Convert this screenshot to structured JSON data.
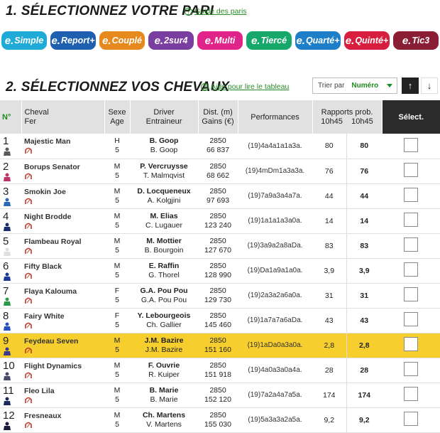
{
  "section1": {
    "title": "1. SÉLECTIONNEZ VOTRE PARI",
    "help": "Guide des paris"
  },
  "bets": [
    {
      "prefix": "e.",
      "label": "Simple",
      "color": "#1faad8"
    },
    {
      "prefix": "e.",
      "label": "Report+",
      "color": "#1e5fb0"
    },
    {
      "prefix": "e.",
      "label": "Couplé",
      "color": "#e68a1e"
    },
    {
      "prefix": "e.",
      "label": "2sur4",
      "color": "#7a3ea0"
    },
    {
      "prefix": "e.",
      "label": "Multi",
      "color": "#e0248a"
    },
    {
      "prefix": "e.",
      "label": "Tiercé",
      "color": "#15a86a"
    },
    {
      "prefix": "e.",
      "label": "Quarté+",
      "color": "#1e7fc8"
    },
    {
      "prefix": "e.",
      "label": "Quinté+",
      "color": "#d81e3e"
    },
    {
      "prefix": "e.",
      "label": "Tic3",
      "color": "#8a1e34"
    }
  ],
  "section2": {
    "title": "2. SÉLECTIONNEZ VOS CHEVAUX",
    "help": "Aide pour lire le tableau"
  },
  "sort": {
    "label": "Trier par",
    "value": "Numéro",
    "up": "↑",
    "down": "↓"
  },
  "columns": {
    "num": "N°",
    "horse": "Cheval",
    "shoe": "Fer",
    "sex": "Sexe",
    "age": "Age",
    "driver": "Driver",
    "trainer": "Entraineur",
    "dist": "Dist. (m)",
    "gains": "Gains (€)",
    "perf": "Performances",
    "odds": "Rapports prob.",
    "odds_t1": "10h45",
    "odds_t2": "10h45",
    "select": "Sélect."
  },
  "rows": [
    {
      "num": "1",
      "name": "Majestic Man",
      "sex": "H",
      "age": "5",
      "driver": "B. Goop",
      "trainer": "B. Goop",
      "dist": "2850",
      "gains": "66 837",
      "perf": "(19)4a4a1a1a3a.",
      "odd1": "80",
      "odd2": "80",
      "jcolor": "#5a5a5a",
      "highlight": false
    },
    {
      "num": "2",
      "name": "Borups Senator",
      "sex": "M",
      "age": "5",
      "driver": "P. Vercruysse",
      "trainer": "T. Malmqvist",
      "dist": "2850",
      "gains": "68 662",
      "perf": "(19)4mDm1a3a3a.",
      "odd1": "76",
      "odd2": "76",
      "jcolor": "#c0306a",
      "highlight": false
    },
    {
      "num": "3",
      "name": "Smokin Joe",
      "sex": "M",
      "age": "5",
      "driver": "D. Locqueneux",
      "trainer": "A. Kolgjini",
      "dist": "2850",
      "gains": "97 693",
      "perf": "(19)7a9a3a4a7a.",
      "odd1": "44",
      "odd2": "44",
      "jcolor": "#2a6ab0",
      "highlight": false
    },
    {
      "num": "4",
      "name": "Night Brodde",
      "sex": "M",
      "age": "5",
      "driver": "M. Elias",
      "trainer": "C. Lugauer",
      "dist": "2850",
      "gains": "123 240",
      "perf": "(19)1a1a1a3a0a.",
      "odd1": "14",
      "odd2": "14",
      "jcolor": "#1a2a6a",
      "highlight": false
    },
    {
      "num": "5",
      "name": "Flambeau Royal",
      "sex": "M",
      "age": "5",
      "driver": "M. Mottier",
      "trainer": "B. Bourgoin",
      "dist": "2850",
      "gains": "127 670",
      "perf": "(19)3a9a2a8aDa.",
      "odd1": "83",
      "odd2": "83",
      "jcolor": "#e0e0e0",
      "highlight": false
    },
    {
      "num": "6",
      "name": "Fifty Black",
      "sex": "M",
      "age": "5",
      "driver": "E. Raffin",
      "trainer": "G. Thorel",
      "dist": "2850",
      "gains": "128 990",
      "perf": "(19)Da1a9a1a0a.",
      "odd1": "3,9",
      "odd2": "3,9",
      "jcolor": "#1a3a9a",
      "highlight": false
    },
    {
      "num": "7",
      "name": "Flaya Kalouma",
      "sex": "F",
      "age": "5",
      "driver": "G.A. Pou Pou",
      "trainer": "G.A. Pou Pou",
      "dist": "2850",
      "gains": "129 730",
      "perf": "(19)2a3a2a6a0a.",
      "odd1": "31",
      "odd2": "31",
      "jcolor": "#2a9a4a",
      "highlight": false
    },
    {
      "num": "8",
      "name": "Fairy White",
      "sex": "F",
      "age": "5",
      "driver": "Y. Lebourgeois",
      "trainer": "Ch. Gallier",
      "dist": "2850",
      "gains": "145 460",
      "perf": "(19)1a7a7a6aDa.",
      "odd1": "43",
      "odd2": "43",
      "jcolor": "#2a50c0",
      "highlight": false
    },
    {
      "num": "9",
      "name": "Feydeau Seven",
      "sex": "M",
      "age": "5",
      "driver": "J.M. Bazire",
      "trainer": "J.M. Bazire",
      "dist": "2850",
      "gains": "151 160",
      "perf": "(19)1aDa0a3a0a.",
      "odd1": "2,8",
      "odd2": "2,8",
      "jcolor": "#3a3a8a",
      "highlight": true
    },
    {
      "num": "10",
      "name": "Flight Dynamics",
      "sex": "M",
      "age": "5",
      "driver": "F. Ouvrie",
      "trainer": "R. Kuiper",
      "dist": "2850",
      "gains": "151 918",
      "perf": "(19)4a0a3a0a4a.",
      "odd1": "28",
      "odd2": "28",
      "jcolor": "#4a4a6a",
      "highlight": false
    },
    {
      "num": "11",
      "name": "Fleo Lila",
      "sex": "M",
      "age": "5",
      "driver": "B. Marie",
      "trainer": "B. Marie",
      "dist": "2850",
      "gains": "152 120",
      "perf": "(19)7a2a4a7a5a.",
      "odd1": "174",
      "odd2": "174",
      "jcolor": "#1a2a5a",
      "highlight": false
    },
    {
      "num": "12",
      "name": "Fresneaux",
      "sex": "M",
      "age": "5",
      "driver": "Ch. Martens",
      "trainer": "V. Martens",
      "dist": "2850",
      "gains": "155 030",
      "perf": "(19)5a3a3a2a5a.",
      "odd1": "9,2",
      "odd2": "9,2",
      "jcolor": "#1a1a3a",
      "highlight": false
    }
  ]
}
